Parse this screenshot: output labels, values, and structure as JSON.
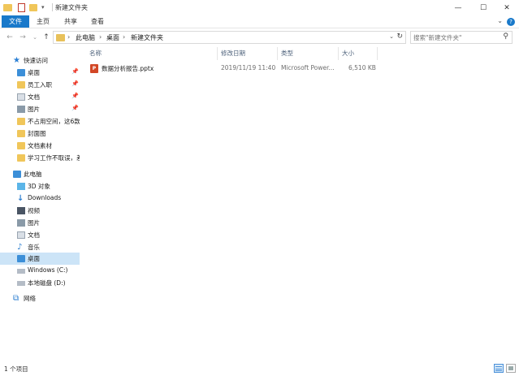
{
  "window": {
    "title": "新建文件夹",
    "controls": {
      "minimize": "—",
      "maximize": "☐",
      "close": "✕"
    }
  },
  "ribbon": {
    "tabs": [
      {
        "label": "文件",
        "active": true
      },
      {
        "label": "主页",
        "active": false
      },
      {
        "label": "共享",
        "active": false
      },
      {
        "label": "查看",
        "active": false
      }
    ],
    "expand_glyph": "⌄",
    "help_glyph": "?"
  },
  "nav": {
    "back": "←",
    "forward": "→",
    "recent": "⌄",
    "up": "↑",
    "breadcrumb": [
      "此电脑",
      "桌面",
      "新建文件夹"
    ],
    "chevron": "›",
    "dropdown": "⌄",
    "refresh": "↻",
    "search_placeholder": "搜索\"新建文件夹\"",
    "search_icon": "⚲"
  },
  "sidebar": {
    "quick_access": {
      "label": "快速访问",
      "items": [
        {
          "label": "桌面",
          "pinned": true,
          "icon": "desktop-icon"
        },
        {
          "label": "员工入职",
          "pinned": true,
          "icon": "folder-icon"
        },
        {
          "label": "文档",
          "pinned": true,
          "icon": "documents-icon"
        },
        {
          "label": "图片",
          "pinned": true,
          "icon": "pictures-icon"
        },
        {
          "label": "不占用空间，这6款",
          "pinned": false,
          "icon": "folder-icon"
        },
        {
          "label": "封面图",
          "pinned": false,
          "icon": "folder-icon"
        },
        {
          "label": "文档素材",
          "pinned": false,
          "icon": "folder-icon"
        },
        {
          "label": "学习工作不取误，差",
          "pinned": false,
          "icon": "folder-icon"
        }
      ]
    },
    "this_pc": {
      "label": "此电脑",
      "items": [
        {
          "label": "3D 对象",
          "icon": "3d-objects-icon"
        },
        {
          "label": "Downloads",
          "icon": "downloads-icon"
        },
        {
          "label": "视频",
          "icon": "videos-icon"
        },
        {
          "label": "图片",
          "icon": "pictures-icon"
        },
        {
          "label": "文档",
          "icon": "documents-icon"
        },
        {
          "label": "音乐",
          "icon": "music-icon"
        },
        {
          "label": "桌面",
          "icon": "desktop-icon",
          "selected": true
        },
        {
          "label": "Windows (C:)",
          "icon": "drive-icon"
        },
        {
          "label": "本地磁盘 (D:)",
          "icon": "drive-icon"
        }
      ]
    },
    "network": {
      "label": "网络"
    }
  },
  "columns": [
    "名称",
    "修改日期",
    "类型",
    "大小"
  ],
  "files": [
    {
      "name": "数据分析报告.pptx",
      "modified": "2019/11/19 11:40",
      "type": "Microsoft Power...",
      "size": "6,510 KB"
    }
  ],
  "status": {
    "item_count": "1 个项目"
  },
  "colors": {
    "accent": "#1979ca",
    "selection": "#cce4f7",
    "folder": "#f0c65a",
    "ppt": "#d24726"
  }
}
